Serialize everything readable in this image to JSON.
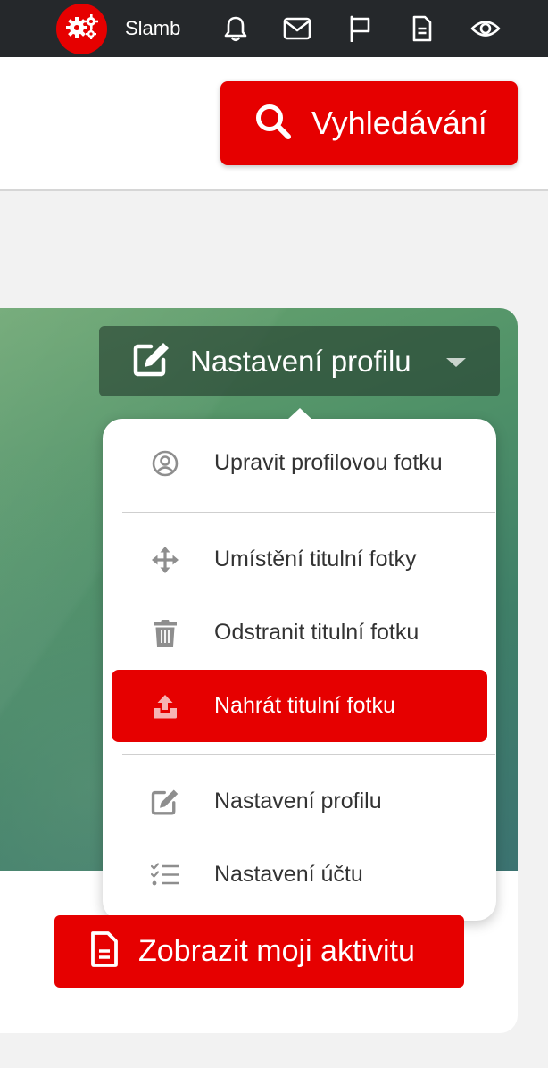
{
  "topbar": {
    "avatar_icon": "gears-icon",
    "username": "Slamb",
    "icons": [
      "bell-icon",
      "mail-icon",
      "flag-icon",
      "document-icon",
      "eye-icon"
    ]
  },
  "search": {
    "label": "Vyhledávání",
    "icon": "search-icon"
  },
  "profile_settings": {
    "label": "Nastavení profilu",
    "icon": "edit-icon"
  },
  "menu": {
    "items": [
      {
        "label": "Upravit profilovou fotku",
        "icon": "user-circle-icon"
      },
      {
        "label": "Umístění titulní fotky",
        "icon": "move-icon"
      },
      {
        "label": "Odstranit titulní fotku",
        "icon": "trash-icon"
      },
      {
        "label": "Nahrát titulní fotku",
        "icon": "upload-icon",
        "active": true
      },
      {
        "label": "Nastavení profilu",
        "icon": "edit-icon"
      },
      {
        "label": "Nastavení účtu",
        "icon": "checklist-icon"
      }
    ]
  },
  "activity": {
    "label": "Zobrazit moji aktivitu",
    "icon": "document-icon"
  },
  "colors": {
    "accent": "#e60000",
    "topbar": "#25282b",
    "cover": "#4f9168"
  }
}
